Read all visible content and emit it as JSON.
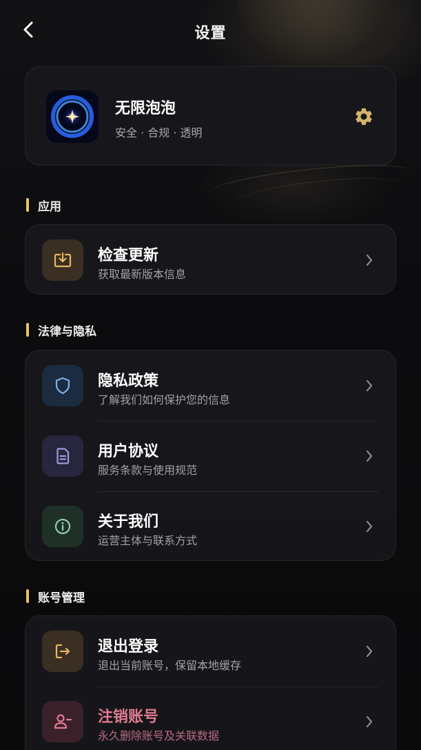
{
  "header": {
    "title": "设置",
    "back_icon": "chevron-left-icon"
  },
  "app": {
    "name": "无限泡泡",
    "tagline": "安全 · 合规 · 透明",
    "settings_icon": "gear-icon",
    "accent": "#d4b46a"
  },
  "sections": [
    {
      "title": "应用",
      "items": [
        {
          "title": "检查更新",
          "subtitle": "获取最新版本信息",
          "icon": "download-box-icon"
        }
      ]
    },
    {
      "title": "法律与隐私",
      "items": [
        {
          "title": "隐私政策",
          "subtitle": "了解我们如何保护您的信息",
          "icon": "shield-icon"
        },
        {
          "title": "用户协议",
          "subtitle": "服务条款与使用规范",
          "icon": "document-icon"
        },
        {
          "title": "关于我们",
          "subtitle": "运营主体与联系方式",
          "icon": "info-icon"
        }
      ]
    },
    {
      "title": "账号管理",
      "items": [
        {
          "title": "退出登录",
          "subtitle": "退出当前账号，保留本地缓存",
          "icon": "logout-icon"
        },
        {
          "title": "注销账号",
          "subtitle": "永久删除账号及关联数据",
          "icon": "remove-user-icon"
        }
      ]
    }
  ],
  "colors": {
    "section_marker": "#e9c369",
    "danger_text": "#e07a93"
  }
}
